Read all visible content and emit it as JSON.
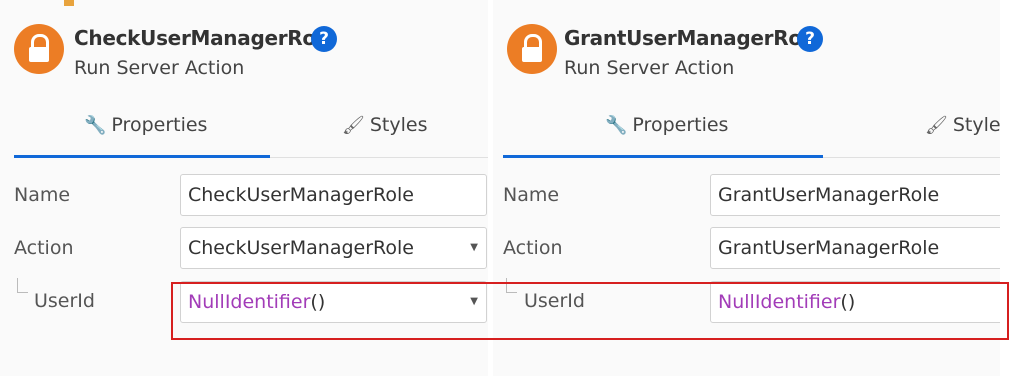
{
  "left": {
    "title": "CheckUserManagerRole",
    "subtitle": "Run Server Action",
    "help": "?",
    "tabs": {
      "properties": "Properties",
      "styles": "Styles"
    },
    "name_label": "Name",
    "name_value": "CheckUserManagerRole",
    "action_label": "Action",
    "action_value": "CheckUserManagerRole",
    "param_label": "UserId",
    "param_func": "NullIdentifier",
    "param_parens": "()"
  },
  "right": {
    "title": "GrantUserManagerRole",
    "subtitle": "Run Server Action",
    "help": "?",
    "tabs": {
      "properties": "Properties",
      "styles": "Styles"
    },
    "name_label": "Name",
    "name_value": "GrantUserManagerRole",
    "action_label": "Action",
    "action_value": "GrantUserManagerRole",
    "param_label": "UserId",
    "param_func": "NullIdentifier",
    "param_parens": "()"
  },
  "icons": {
    "lock": "lock-icon",
    "help": "help-icon",
    "properties": "wrench-icon",
    "styles": "brush-icon",
    "dropdown": "chevron-down-icon"
  },
  "colors": {
    "accent": "#1068d8",
    "lock": "#ec7d25",
    "expression": "#a23cb8",
    "highlight": "#d61f1f"
  }
}
